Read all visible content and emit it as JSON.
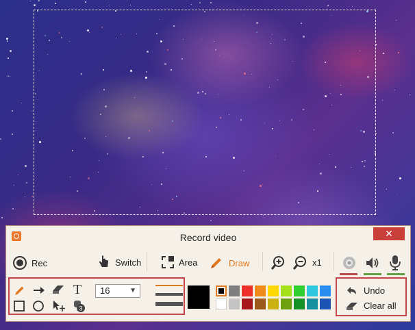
{
  "window": {
    "title": "Record video",
    "close_glyph": "✕"
  },
  "toolbar": {
    "rec_label": "Rec",
    "switch_label": "Switch",
    "area_label": "Area",
    "draw_label": "Draw",
    "zoom_level": "x1"
  },
  "draw_panel": {
    "font_size": "16",
    "text_tool_glyph": "T",
    "step_badge": "3"
  },
  "actions": {
    "undo_label": "Undo",
    "clear_label": "Clear all"
  },
  "colors": {
    "accent": "#e07a20",
    "highlight_border": "#c5444a",
    "close_red": "#c9403b",
    "webcam_indicator": "#b84a48",
    "audio_indicator": "#5fa043",
    "palette_top": [
      "#000000",
      "#7f7f7f",
      "#ec3029",
      "#f08a1c",
      "#ffd800",
      "#a5e01a",
      "#31cf31",
      "#2fc7e0",
      "#2a8ef0"
    ],
    "palette_bottom": [
      "#ffffff",
      "#c4c4c4",
      "#a6161a",
      "#9b5a1c",
      "#c9b211",
      "#6fa010",
      "#15912a",
      "#178f9f",
      "#1b54b5"
    ]
  }
}
